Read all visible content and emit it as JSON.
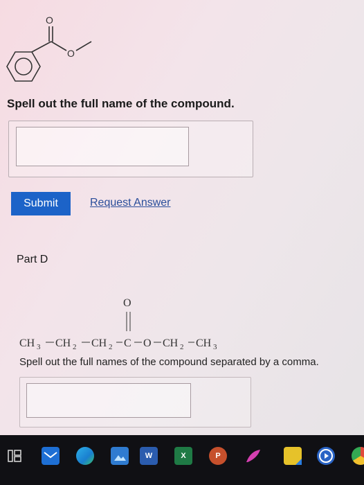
{
  "question1": {
    "prompt": "Spell out the full name of the compound.",
    "answer_value": "",
    "molecule_labels": {
      "carbonyl_o": "O",
      "ester_o": "O"
    }
  },
  "actions": {
    "submit_label": "Submit",
    "request_answer_label": "Request Answer"
  },
  "part_d": {
    "title": "Part D",
    "formula": {
      "carbonyl_o": "O",
      "ch3_a": "CH",
      "sub3_a": "3",
      "ch2_a": "CH",
      "sub2_a": "2",
      "ch2_b": "CH",
      "sub2_b": "2",
      "c": "C",
      "o": "O",
      "ch2_c": "CH",
      "sub2_c": "2",
      "ch3_b": "CH",
      "sub3_b": "3"
    },
    "prompt": "Spell out the full names of the compound separated by a comma.",
    "answer_value": ""
  },
  "taskbar": {
    "icons": [
      "task-view-icon",
      "mail-icon",
      "edge-icon",
      "photos-icon",
      "word-icon",
      "excel-icon",
      "powerpoint-icon",
      "feather-app-icon",
      "sticky-notes-icon",
      "media-player-icon",
      "chrome-icon"
    ],
    "word_label": "W",
    "excel_label": "X",
    "powerpoint_label": "P"
  },
  "colors": {
    "submit_bg": "#1c63c8",
    "link": "#2a4d9a",
    "taskbar_bg": "#101014"
  }
}
